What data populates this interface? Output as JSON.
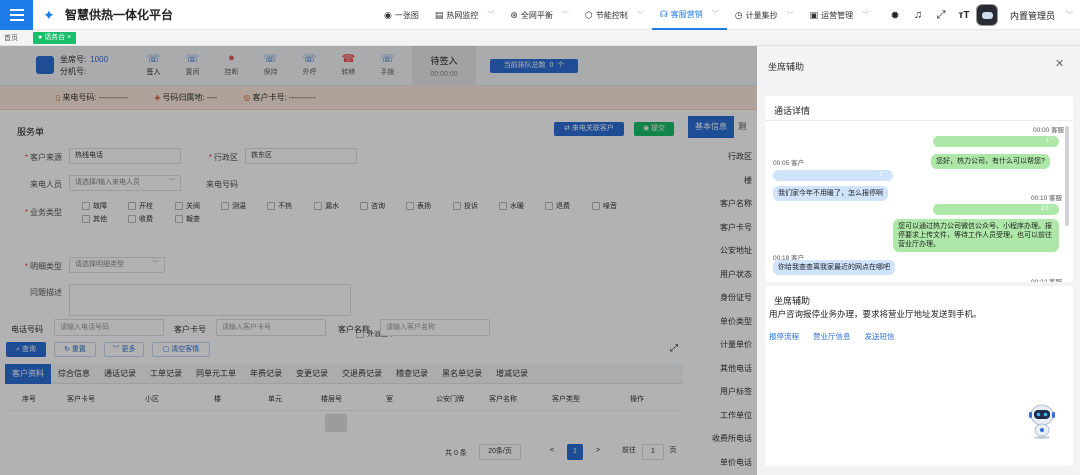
{
  "app": {
    "title": "智慧供热一体化平台"
  },
  "nav": [
    {
      "label": "一张图",
      "icon": "globe-icon",
      "glyph": "◉",
      "has_menu": false,
      "active": false
    },
    {
      "label": "热网监控",
      "icon": "monitor-icon",
      "glyph": "▤",
      "has_menu": true,
      "active": false
    },
    {
      "label": "全网平衡",
      "icon": "balance-icon",
      "glyph": "⊛",
      "has_menu": true,
      "active": false
    },
    {
      "label": "节能控制",
      "icon": "energy-icon",
      "glyph": "⬡",
      "has_menu": true,
      "active": false
    },
    {
      "label": "客服营销",
      "icon": "headset-icon",
      "glyph": "☊",
      "has_menu": true,
      "active": true
    },
    {
      "label": "计量集抄",
      "icon": "meter-icon",
      "glyph": "◷",
      "has_menu": true,
      "active": false
    },
    {
      "label": "运营管理",
      "icon": "operation-icon",
      "glyph": "▣",
      "has_menu": true,
      "active": false
    }
  ],
  "user": {
    "name": "内置管理员"
  },
  "tabs": {
    "home": "首页",
    "active": "话务台"
  },
  "callbar": {
    "seat_label": "坐席号:",
    "seat_no": "1000",
    "ext_label": "分机号:",
    "buttons": [
      "签入",
      "置闲",
      "挂断",
      "保持",
      "外呼",
      "转移",
      "手拨"
    ],
    "wait_status": "待签入",
    "wait_time": "00:00:00",
    "queue_label": "当前排队总数",
    "queue_count": "0"
  },
  "caller": {
    "phone_label": "来电号码:",
    "phone_value": "-----------",
    "location_label": "号码归属地:",
    "location_value": "----",
    "card_label": "客户卡号:",
    "card_value": "----------"
  },
  "form": {
    "title": "服务单",
    "caller_btn": "来电关联客户",
    "submit_btn": "提交",
    "source_label": "客户来源",
    "source_value": "热线电话",
    "district_label": "行政区",
    "district_value": "铁东区",
    "caller_label": "来电人员",
    "caller_placeholder": "请选择/输入来电人员",
    "phone_label": "来电号码",
    "biz_label": "业务类型",
    "biz_types": [
      "故障",
      "开栓",
      "关阀",
      "测温",
      "不热",
      "漏水",
      "咨询",
      "表扬",
      "投诉",
      "水暖",
      "退费",
      "噪音",
      "其他",
      "收费",
      "報查"
    ],
    "detail_label": "明细类型",
    "detail_placeholder": "请选择明细类型",
    "desc_label": "问题描述",
    "outbound_label": "外派工单"
  },
  "info": {
    "tab_basic": "基本信息",
    "tab_second": "测",
    "fields": [
      "行政区",
      "楼",
      "客户名称",
      "客户卡号",
      "公安地址",
      "用户状态",
      "身份证号",
      "单价类型",
      "计量单价",
      "其他电话",
      "用户标签",
      "工作单位",
      "收费所电话",
      "单价电话"
    ]
  },
  "search": {
    "phone_label": "电话号码",
    "phone_placeholder": "请输入电话号码",
    "card_label": "客户卡号",
    "card_placeholder": "请输入客户卡号",
    "name_label": "客户名称",
    "name_placeholder": "请输入客户名称",
    "query": "查询",
    "reset": "重置",
    "more": "更多",
    "clear": "清空客情"
  },
  "records": {
    "tabs": [
      "客户资料",
      "综合信息",
      "通话记录",
      "工单记录",
      "同单元工单",
      "年费记录",
      "变更记录",
      "交退费记录",
      "稽查记录",
      "黑名单记录",
      "增减记录"
    ],
    "columns": [
      "序号",
      "客户卡号",
      "小区",
      "楼",
      "单元",
      "楼层号",
      "室",
      "公安门牌",
      "客户名称",
      "客户类型",
      "操作"
    ]
  },
  "pager": {
    "total": "共 0 条",
    "page_size": "20条/页",
    "prev": "<",
    "page": "1",
    "next": ">",
    "goto": "前往",
    "goto_value": "1",
    "unit": "页"
  },
  "rpanel": {
    "title": "坐席辅助",
    "call_title": "通话详情",
    "messages": [
      {
        "time": "00:00 客服",
        "role": "agent",
        "kind": "voice",
        "text": "1''"
      },
      {
        "time": "",
        "role": "agent",
        "kind": "text",
        "text": "您好，热力公司，有什么可以帮您?"
      },
      {
        "time": "00:05 客户",
        "role": "cust",
        "kind": "voice",
        "text": "2''"
      },
      {
        "time": "",
        "role": "cust",
        "kind": "text",
        "text": "我们家今年不用暖了，怎么报停啊"
      },
      {
        "time": "00:10 客服",
        "role": "agent",
        "kind": "voice",
        "text": "22''"
      },
      {
        "time": "",
        "role": "agent",
        "kind": "text",
        "text": "您可以通过热力公司微信公众号、小程序办理。报停要求上传文件，等待工作人员受理，也可以前往营业厅办理。"
      },
      {
        "time": "00:18 客户",
        "role": "cust",
        "kind": "text",
        "text": "你给我查查离我家最近的网点在哪吧"
      },
      {
        "time": "00:22 客服",
        "role": "agent",
        "kind": "text",
        "text": ""
      }
    ],
    "assist_title": "坐席辅助",
    "assist_text": "用户咨询报停业务办理，要求将营业厅地址发送到手机。",
    "assist_links": [
      "报停流程",
      "营业厅信息",
      "发送短信"
    ]
  }
}
